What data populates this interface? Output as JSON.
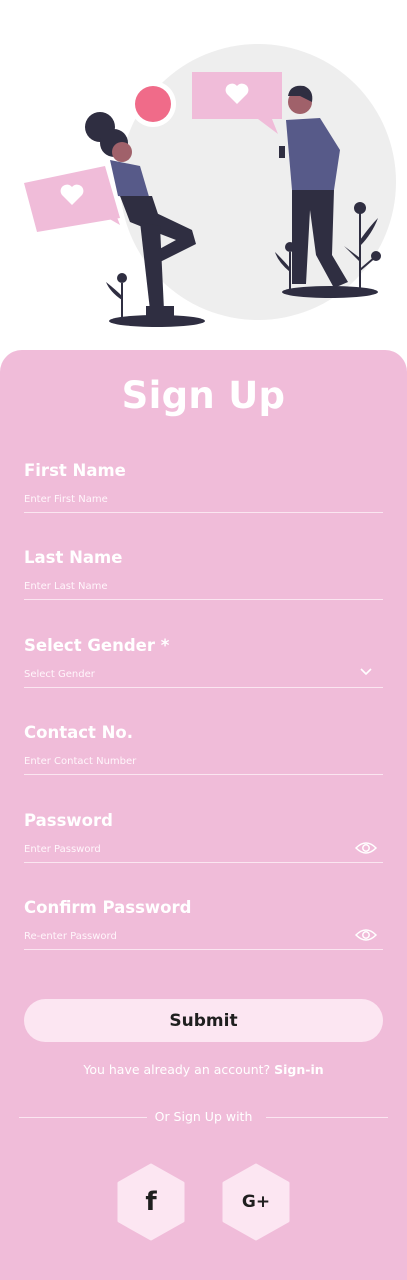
{
  "form": {
    "title": "Sign Up",
    "fields": [
      {
        "label": "First Name",
        "placeholder": "Enter First Name"
      },
      {
        "label": "Last Name",
        "placeholder": "Enter Last Name"
      },
      {
        "label": "Select Gender *",
        "placeholder": "Select Gender"
      },
      {
        "label": "Contact No.",
        "placeholder": "Enter Contact Number"
      },
      {
        "label": "Password",
        "placeholder": "Enter Password"
      },
      {
        "label": "Confirm Password",
        "placeholder": "Re-enter Password"
      }
    ],
    "submit_label": "Submit",
    "signin_prompt": "You have  already an account?",
    "signin_link": "Sign-in",
    "divider_text": "Or Sign Up with"
  },
  "social": {
    "facebook_glyph": "f",
    "google_glyph": "G+"
  },
  "colors": {
    "card": "#f0bcd9",
    "button": "#fce6f2",
    "accent": "#f06b89",
    "dark": "#2f2e41"
  },
  "icons": [
    "heart-icon",
    "chevron-down-icon",
    "eye-icon",
    "facebook-icon",
    "google-plus-icon"
  ]
}
